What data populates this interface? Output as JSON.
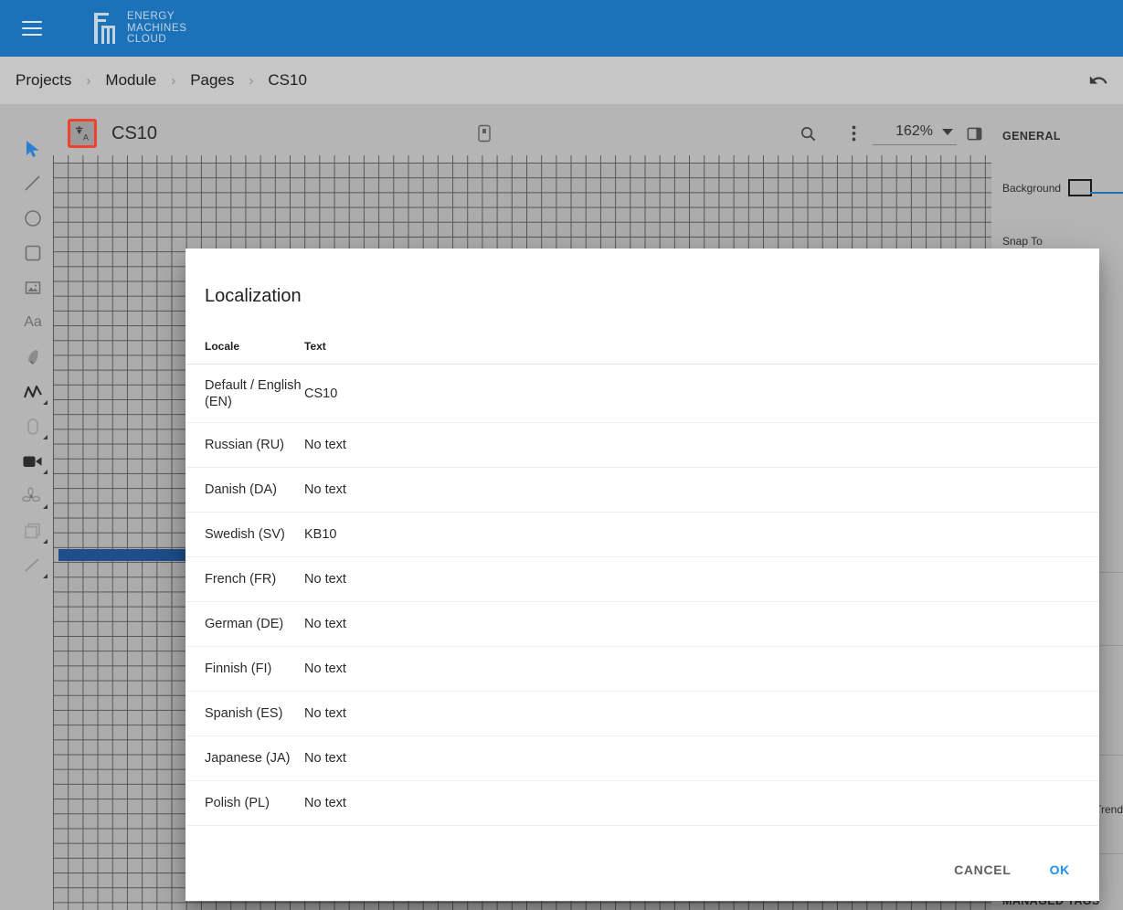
{
  "topbar": {
    "menu_icon": "hamburger-menu-icon",
    "logo_icon": "energy-machines-logo-icon",
    "logo_line1": "ENERGY",
    "logo_line2": "MACHINES",
    "logo_line3": "CLOUD",
    "background_color": "#1b72b8"
  },
  "breadcrumb": {
    "items": [
      {
        "label": "Projects"
      },
      {
        "label": "Module"
      },
      {
        "label": "Pages"
      },
      {
        "label": "CS10"
      }
    ],
    "separator": "›",
    "undo_icon": "undo-arrow-icon"
  },
  "toolrail": {
    "tools": [
      {
        "name": "select-cursor-tool",
        "icon": "cursor-arrow-icon",
        "active": true,
        "submenu": false
      },
      {
        "name": "line-tool",
        "icon": "diagonal-line-icon",
        "active": false,
        "submenu": false
      },
      {
        "name": "ellipse-tool",
        "icon": "circle-icon",
        "active": false,
        "submenu": false
      },
      {
        "name": "rectangle-tool",
        "icon": "square-icon",
        "active": false,
        "submenu": false
      },
      {
        "name": "image-tool",
        "icon": "image-icon",
        "active": false,
        "submenu": false
      },
      {
        "name": "text-tool",
        "icon": "text-aa-icon",
        "active": false,
        "submenu": false
      },
      {
        "name": "pen-tool",
        "icon": "pen-nib-icon",
        "active": false,
        "submenu": false
      },
      {
        "name": "polyline-tool",
        "icon": "polyline-icon",
        "active": false,
        "submenu": true
      },
      {
        "name": "gauge-tool",
        "icon": "gauge-capsule-icon",
        "active": false,
        "submenu": true
      },
      {
        "name": "camera-tool",
        "icon": "video-camera-icon",
        "active": true,
        "submenu": true
      },
      {
        "name": "fan-tool",
        "icon": "fan-propeller-icon",
        "active": false,
        "submenu": true
      },
      {
        "name": "container-tool",
        "icon": "stacked-squares-icon",
        "active": false,
        "submenu": true
      },
      {
        "name": "connector-tool",
        "icon": "diagonal-line-icon",
        "active": false,
        "submenu": true
      }
    ]
  },
  "editor_toolbar": {
    "localization_button_icon": "translate-icon",
    "localization_highlight_color": "#f0432f",
    "page_title": "CS10",
    "device_icon": "device-preview-icon",
    "search_icon": "search-icon",
    "more_icon": "more-vertical-icon",
    "zoom_value": "162%",
    "panel_toggle_icon": "panel-toggle-icon"
  },
  "canvas": {
    "grid_visible": true,
    "shape_color": "#1f4e8c"
  },
  "properties": {
    "section_title": "GENERAL",
    "background_label": "Background",
    "background_color": "#b0b0b0",
    "snap_to_label": "Snap To",
    "trend_label": "Trend",
    "managed_tags_title": "MANAGED TAGS",
    "accent_color": "#1b72b8"
  },
  "dialog": {
    "title": "Localization",
    "columns": {
      "locale": "Locale",
      "text": "Text"
    },
    "rows": [
      {
        "locale": "Default / English (EN)",
        "text": "CS10",
        "tall": true
      },
      {
        "locale": "Russian (RU)",
        "text": "No text",
        "tall": false
      },
      {
        "locale": "Danish (DA)",
        "text": "No text",
        "tall": false
      },
      {
        "locale": "Swedish (SV)",
        "text": "KB10",
        "tall": false
      },
      {
        "locale": "French (FR)",
        "text": "No text",
        "tall": false
      },
      {
        "locale": "German (DE)",
        "text": "No text",
        "tall": false
      },
      {
        "locale": "Finnish (FI)",
        "text": "No text",
        "tall": false
      },
      {
        "locale": "Spanish (ES)",
        "text": "No text",
        "tall": false
      },
      {
        "locale": "Japanese (JA)",
        "text": "No text",
        "tall": false
      },
      {
        "locale": "Polish (PL)",
        "text": "No text",
        "tall": false
      }
    ],
    "cancel_label": "CANCEL",
    "ok_label": "OK",
    "ok_color": "#1f8ff5"
  }
}
